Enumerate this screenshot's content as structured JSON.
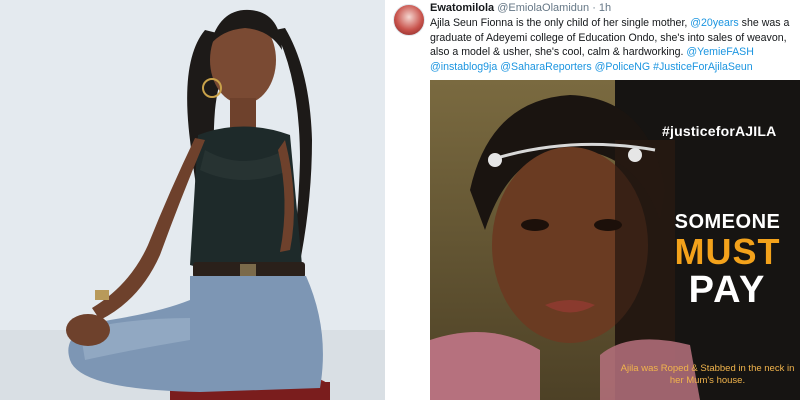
{
  "tweet": {
    "display_name": "Ewatomilola",
    "handle": "@EmiolaOlamidun",
    "time": "1h",
    "segments": [
      {
        "t": "Ajila Seun Fionna is the only child of her single mother, ",
        "k": "text"
      },
      {
        "t": "@20years",
        "k": "mention"
      },
      {
        "t": " she was a graduate of Adeyemi college of Education Ondo, she's into sales of weavon, also a model & usher, she's cool, calm & hardworking. ",
        "k": "text"
      },
      {
        "t": "@YemieFASH",
        "k": "mention"
      },
      {
        "t": " ",
        "k": "text"
      },
      {
        "t": "@instablog9ja",
        "k": "mention"
      },
      {
        "t": " ",
        "k": "text"
      },
      {
        "t": "@SaharaReporters",
        "k": "mention"
      },
      {
        "t": " ",
        "k": "text"
      },
      {
        "t": "@PoliceNG",
        "k": "mention"
      },
      {
        "t": " ",
        "k": "text"
      },
      {
        "t": "#JusticeForAjilaSeun",
        "k": "tag"
      }
    ]
  },
  "poster": {
    "hashtag": "#justiceforAJILA",
    "headline_1": "SOMEONE",
    "headline_2": "MUST",
    "headline_3": "PAY",
    "caption": "Ajila was Roped & Stabbed in the neck in her Mum's house.",
    "colors": {
      "accent": "#f3a21b",
      "link": "#1b95e0"
    }
  }
}
